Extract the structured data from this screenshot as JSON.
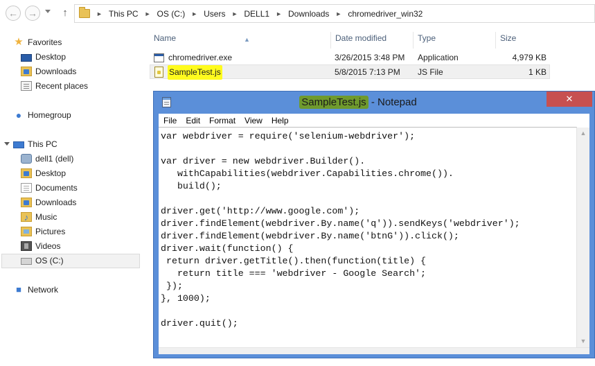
{
  "window": {
    "background": "#ffffff"
  },
  "address_bar": {
    "crumbs": [
      "This PC",
      "OS (C:)",
      "Users",
      "DELL1",
      "Downloads",
      "chromedriver_win32"
    ]
  },
  "navigation": {
    "favorites": {
      "label": "Favorites",
      "items": [
        "Desktop",
        "Downloads",
        "Recent places"
      ]
    },
    "homegroup": {
      "label": "Homegroup"
    },
    "this_pc": {
      "label": "This PC",
      "items": [
        "dell1 (dell)",
        "Desktop",
        "Documents",
        "Downloads",
        "Music",
        "Pictures",
        "Videos",
        "OS (C:)"
      ]
    },
    "network": {
      "label": "Network"
    }
  },
  "file_list": {
    "columns": {
      "name": "Name",
      "date": "Date modified",
      "type": "Type",
      "size": "Size"
    },
    "rows": [
      {
        "name": "chromedriver.exe",
        "date": "3/26/2015 3:48 PM",
        "type": "Application",
        "size": "4,979 KB",
        "icon": "exe-icon"
      },
      {
        "name": "SampleTest.js",
        "date": "5/8/2015 7:13 PM",
        "type": "JS File",
        "size": "1 KB",
        "icon": "js-file-icon",
        "highlight": "#fffb1e"
      }
    ]
  },
  "notepad": {
    "file_name": "SampleTest.js",
    "app_suffix": "- Notepad",
    "title_highlight": "#6f9a2d",
    "close_glyph": "✕",
    "close_color": "#c75050",
    "frame_color": "#5b8fd9",
    "menu": [
      "File",
      "Edit",
      "Format",
      "View",
      "Help"
    ],
    "lines": [
      "var webdriver = require('selenium-webdriver');",
      "",
      "var driver = new webdriver.Builder().",
      "   withCapabilities(webdriver.Capabilities.chrome()).",
      "   build();",
      "",
      "driver.get('http://www.google.com');",
      "driver.findElement(webdriver.By.name('q')).sendKeys('webdriver');",
      "driver.findElement(webdriver.By.name('btnG')).click();",
      "driver.wait(function() {",
      " return driver.getTitle().then(function(title) {",
      "   return title === 'webdriver - Google Search';",
      " });",
      "}, 1000);",
      "",
      "driver.quit();"
    ]
  }
}
